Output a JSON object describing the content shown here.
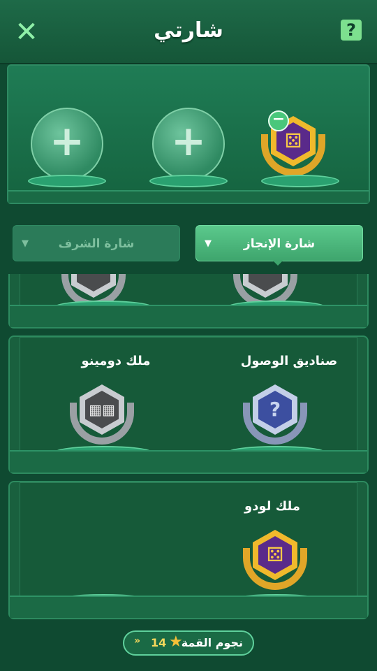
{
  "header": {
    "title": "شارتي",
    "close_icon": "✕",
    "help_icon": "?"
  },
  "showcase": {
    "slot_plus": "+",
    "equipped_badge": "ملك لودو",
    "remove_icon": "−"
  },
  "tabs": [
    {
      "label": "شارة الإنجاز",
      "caret": "▼",
      "active": true
    },
    {
      "label": "شارة الشرف",
      "caret": "▼",
      "active": false
    }
  ],
  "badges": [
    {
      "label": "",
      "style": "silver"
    },
    {
      "label": "",
      "style": "silver"
    },
    {
      "label": "صناديق الوصول",
      "style": "blue",
      "glyph": "?"
    },
    {
      "label": "ملك دومينو",
      "style": "silver",
      "glyph": "▦▦"
    },
    {
      "label": "ملك لودو",
      "style": "gold",
      "glyph": "⚄"
    }
  ],
  "footer": {
    "label": "نجوم القمة",
    "count": "14",
    "star_icon": "★",
    "chevron": "»"
  },
  "colors": {
    "background": "#0f4a31",
    "accent": "#5bc98c",
    "gold": "#f0b92c",
    "purple": "#5a2a8a"
  }
}
